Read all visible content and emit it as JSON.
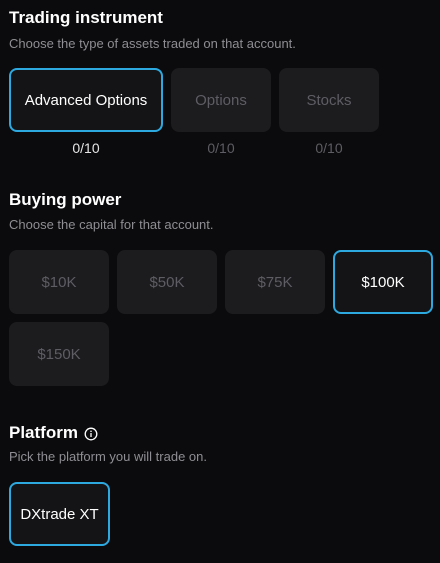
{
  "trading_instrument": {
    "title": "Trading instrument",
    "subtitle": "Choose the type of assets traded on that account.",
    "options": [
      {
        "label": "Advanced Options",
        "count": "0/10",
        "selected": true
      },
      {
        "label": "Options",
        "count": "0/10",
        "selected": false
      },
      {
        "label": "Stocks",
        "count": "0/10",
        "selected": false
      }
    ]
  },
  "buying_power": {
    "title": "Buying power",
    "subtitle": "Choose the capital for that account.",
    "options": [
      {
        "label": "$10K",
        "selected": false
      },
      {
        "label": "$50K",
        "selected": false
      },
      {
        "label": "$75K",
        "selected": false
      },
      {
        "label": "$100K",
        "selected": true
      },
      {
        "label": "$150K",
        "selected": false
      }
    ]
  },
  "platform": {
    "title": "Platform",
    "info_icon": "info-circle-icon",
    "subtitle": "Pick the platform you will trade on.",
    "options": [
      {
        "label": "DXtrade XT",
        "selected": true
      }
    ]
  },
  "colors": {
    "background": "#0b0b0d",
    "card": "#1c1c1f",
    "accent": "#2ea9e0",
    "muted_text": "#5d5d63",
    "subtitle_text": "#8e8e93"
  }
}
